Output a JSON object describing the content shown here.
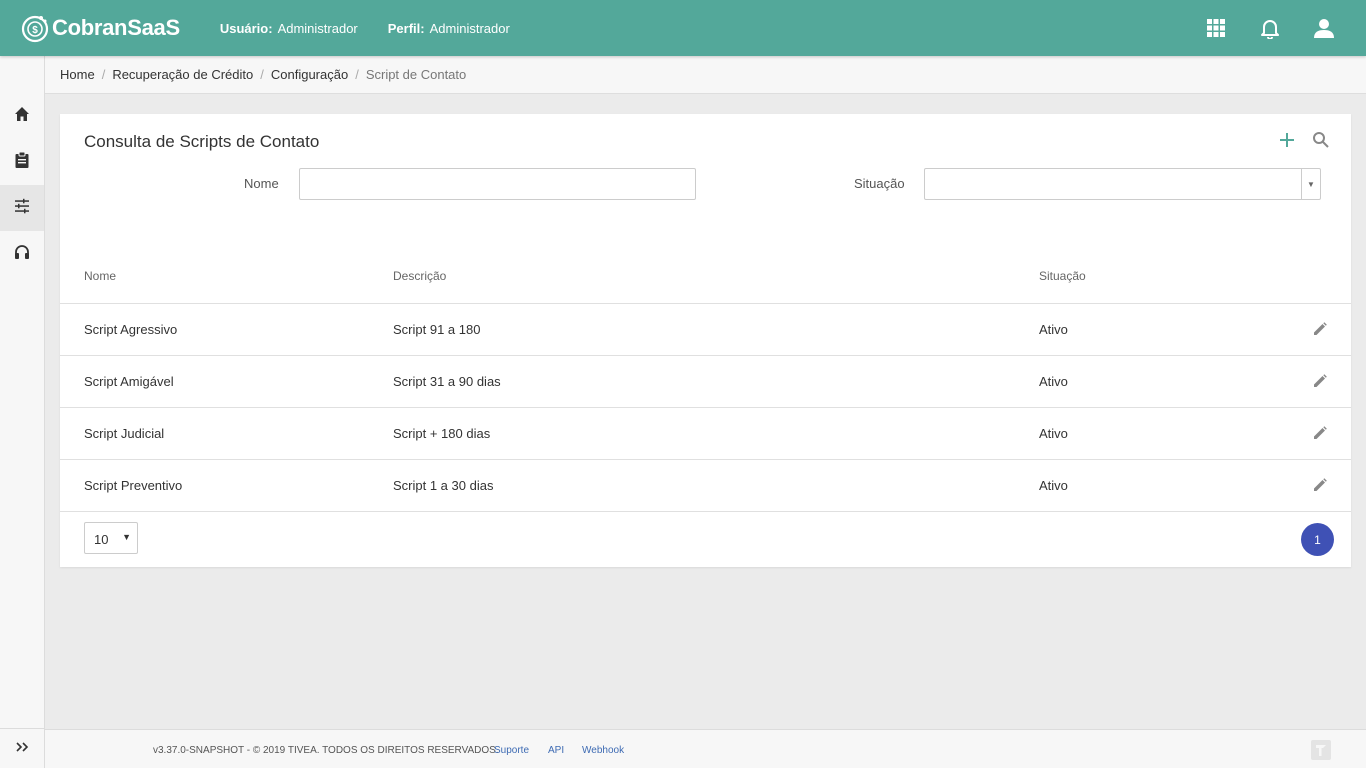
{
  "app": {
    "name": "CobranSaaS",
    "user_label": "Usuário:",
    "user_value": "Administrador",
    "profile_label": "Perfil:",
    "profile_value": "Administrador",
    "brand_color": "#53a89a"
  },
  "top_icons": [
    "apps-grid-icon",
    "notifications-bell-icon",
    "account-icon"
  ],
  "sidebar": {
    "items": [
      {
        "icon": "home-icon"
      },
      {
        "icon": "clipboard-icon"
      },
      {
        "icon": "tune-sliders-icon",
        "active": true
      },
      {
        "icon": "headset-icon"
      }
    ],
    "expand_icon": "double-chevron-right-icon"
  },
  "breadcrumb": [
    "Home",
    "Recuperação de Crédito",
    "Configuração",
    "Script de Contato"
  ],
  "card": {
    "title": "Consulta de Scripts de Contato",
    "add_icon": "plus-icon",
    "search_icon": "search-icon"
  },
  "filters": {
    "nome_label": "Nome",
    "nome_value": "",
    "situacao_label": "Situação",
    "situacao_value": ""
  },
  "table": {
    "headers": [
      "Nome",
      "Descrição",
      "Situação"
    ],
    "rows": [
      {
        "nome": "Script Agressivo",
        "descricao": "Script 91 a 180",
        "situacao": "Ativo"
      },
      {
        "nome": "Script Amigável",
        "descricao": "Script 31 a 90 dias",
        "situacao": "Ativo"
      },
      {
        "nome": "Script Judicial",
        "descricao": "Script + 180 dias",
        "situacao": "Ativo"
      },
      {
        "nome": "Script Preventivo",
        "descricao": "Script 1 a 30 dias",
        "situacao": "Ativo"
      }
    ]
  },
  "pagination": {
    "page_size": "10",
    "current_page": "1",
    "accent": "#3f51b5"
  },
  "footer": {
    "copyright": "v3.37.0-SNAPSHOT - © 2019 TIVEA. TODOS OS DIREITOS RESERVADOS.",
    "links": [
      "Suporte",
      "API",
      "Webhook"
    ]
  }
}
